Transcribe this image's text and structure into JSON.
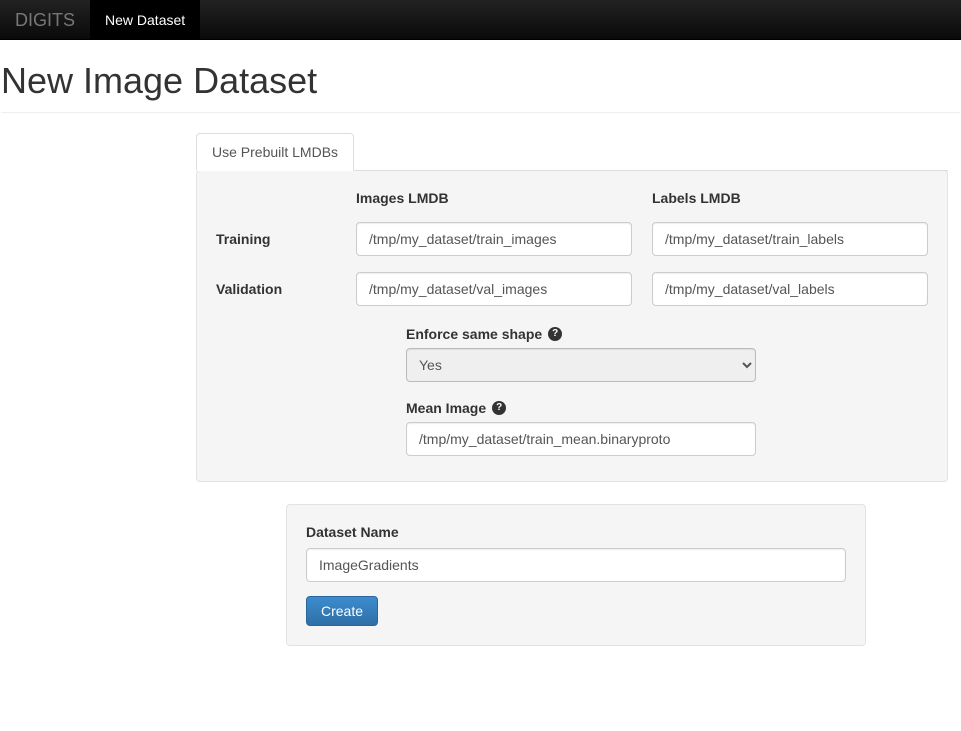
{
  "nav": {
    "brand": "DIGITS",
    "active_item": "New Dataset"
  },
  "page": {
    "title": "New Image Dataset"
  },
  "tabs": {
    "prebuilt_lmdbs": "Use Prebuilt LMDBs"
  },
  "lmdb": {
    "col_images": "Images LMDB",
    "col_labels": "Labels LMDB",
    "row_training": "Training",
    "row_validation": "Validation",
    "train_images": "/tmp/my_dataset/train_images",
    "train_labels": "/tmp/my_dataset/train_labels",
    "val_images": "/tmp/my_dataset/val_images",
    "val_labels": "/tmp/my_dataset/val_labels"
  },
  "options": {
    "enforce_shape_label": "Enforce same shape",
    "enforce_shape_value": "Yes",
    "mean_image_label": "Mean Image",
    "mean_image_value": "/tmp/my_dataset/train_mean.binaryproto"
  },
  "dataset": {
    "name_label": "Dataset Name",
    "name_value": "ImageGradients",
    "create_label": "Create"
  }
}
